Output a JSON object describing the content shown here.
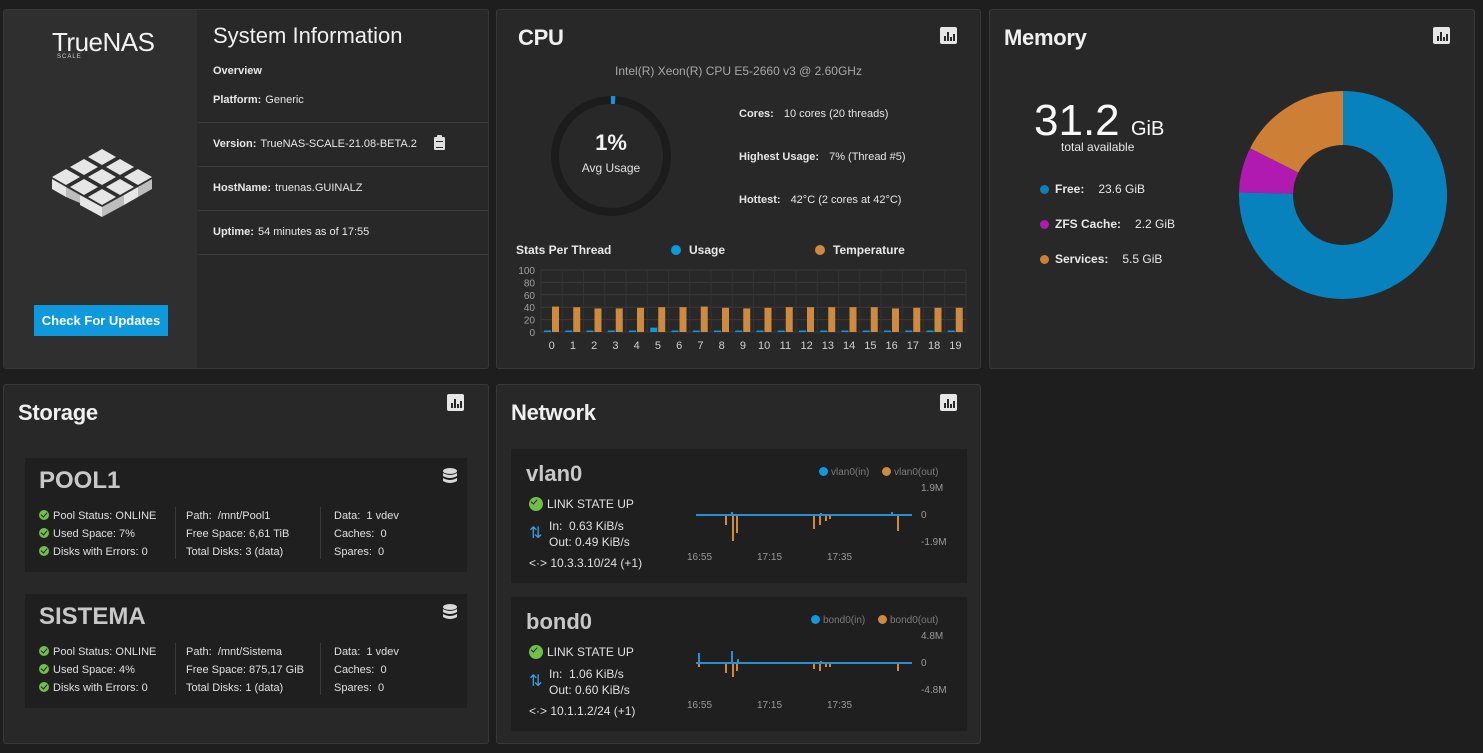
{
  "system": {
    "logo": "TrueNAS",
    "logo_sub": "SCALE",
    "title": "System Information",
    "overview_label": "Overview",
    "platform_label": "Platform:",
    "platform": "Generic",
    "version_label": "Version:",
    "version": "TrueNAS-SCALE-21.08-BETA.2",
    "hostname_label": "HostName:",
    "hostname": "truenas.GUINALZ",
    "uptime_label": "Uptime:",
    "uptime": "54 minutes as of 17:55",
    "update_button": "Check For Updates"
  },
  "cpu": {
    "title": "CPU",
    "model": "Intel(R) Xeon(R) CPU E5-2660 v3 @ 2.60GHz",
    "usage_value": "1%",
    "usage_label": "Avg Usage",
    "usage_fraction": 0.01,
    "cores_label": "Cores:",
    "cores": "10 cores  (20 threads)",
    "highest_label": "Highest Usage:",
    "highest": "7%  (Thread #5)",
    "hottest_label": "Hottest:",
    "hottest": "42°C  (2 cores at 42°C)",
    "threads_title": "Stats Per Thread",
    "legend_usage": "Usage",
    "legend_temp": "Temperature",
    "colors": {
      "usage": "#0d99dc",
      "temperature": "#ce8a3e"
    }
  },
  "chart_data": {
    "type": "bar",
    "categories": [
      "0",
      "1",
      "2",
      "3",
      "4",
      "5",
      "6",
      "7",
      "8",
      "9",
      "10",
      "11",
      "12",
      "13",
      "14",
      "15",
      "16",
      "17",
      "18",
      "19"
    ],
    "series": [
      {
        "name": "Usage",
        "values": [
          1,
          0,
          0,
          0,
          2,
          7,
          2,
          0,
          0,
          2,
          0,
          1,
          2,
          0,
          0,
          0,
          0,
          0,
          0,
          0
        ]
      },
      {
        "name": "Temperature",
        "values": [
          41,
          40,
          38,
          38,
          39,
          40,
          40,
          41,
          39,
          38,
          39,
          40,
          40,
          40,
          40,
          40,
          38,
          39,
          39,
          39
        ]
      }
    ],
    "ylim": [
      0,
      100
    ],
    "yticks": [
      "100",
      "80",
      "60",
      "40",
      "20",
      "0"
    ]
  },
  "memory": {
    "title": "Memory",
    "total": "31.2",
    "unit": "GiB",
    "total_label": "total available",
    "free_label": "Free:",
    "free": "23.6 GiB",
    "zfs_label": "ZFS Cache:",
    "zfs": "2.2 GiB",
    "services_label": "Services:",
    "services": "5.5 GiB",
    "values": [
      23.6,
      2.2,
      5.5
    ],
    "colors": [
      "#0882bd",
      "#b01ab0",
      "#cd7f35"
    ]
  },
  "storage": {
    "title": "Storage",
    "pools": [
      {
        "name": "POOL1",
        "status_label": "Pool Status:",
        "status": "ONLINE",
        "used_label": "Used Space:",
        "used": "7%",
        "errors_label": "Disks with Errors:",
        "errors": "0",
        "path_label": "Path:",
        "path": "/mnt/Pool1",
        "free_label": "Free Space:",
        "free": "6,61 TiB",
        "disks_label": "Total Disks:",
        "disks": "3 (data)",
        "data_label": "Data:",
        "data": "1 vdev",
        "caches_label": "Caches:",
        "caches": "0",
        "spares_label": "Spares:",
        "spares": "0"
      },
      {
        "name": "SISTEMA",
        "status_label": "Pool Status:",
        "status": "ONLINE",
        "used_label": "Used Space:",
        "used": "4%",
        "errors_label": "Disks with Errors:",
        "errors": "0",
        "path_label": "Path:",
        "path": "/mnt/Sistema",
        "free_label": "Free Space:",
        "free": "875,17 GiB",
        "disks_label": "Total Disks:",
        "disks": "1 (data)",
        "data_label": "Data:",
        "data": "1 vdev",
        "caches_label": "Caches:",
        "caches": "0",
        "spares_label": "Spares:",
        "spares": "0"
      }
    ]
  },
  "network": {
    "title": "Network",
    "interfaces": [
      {
        "name": "vlan0",
        "state": "LINK STATE UP",
        "in_label": "In:",
        "in": "0.63 KiB/s",
        "out_label": "Out:",
        "out": "0.49 KiB/s",
        "ip": "10.3.3.10/24 (+1)",
        "legend_in": "vlan0(in)",
        "legend_out": "vlan0(out)",
        "y_top": "1.9M",
        "y_mid": "0",
        "y_bot": "-1.9M",
        "x_ticks": [
          "16:55",
          "17:15",
          "17:35"
        ]
      },
      {
        "name": "bond0",
        "state": "LINK STATE UP",
        "in_label": "In:",
        "in": "1.06 KiB/s",
        "out_label": "Out:",
        "out": "0.60 KiB/s",
        "ip": "10.1.1.2/24 (+1)",
        "legend_in": "bond0(in)",
        "legend_out": "bond0(out)",
        "y_top": "4.8M",
        "y_mid": "0",
        "y_bot": "-4.8M",
        "x_ticks": [
          "16:55",
          "17:15",
          "17:35"
        ]
      }
    ]
  }
}
